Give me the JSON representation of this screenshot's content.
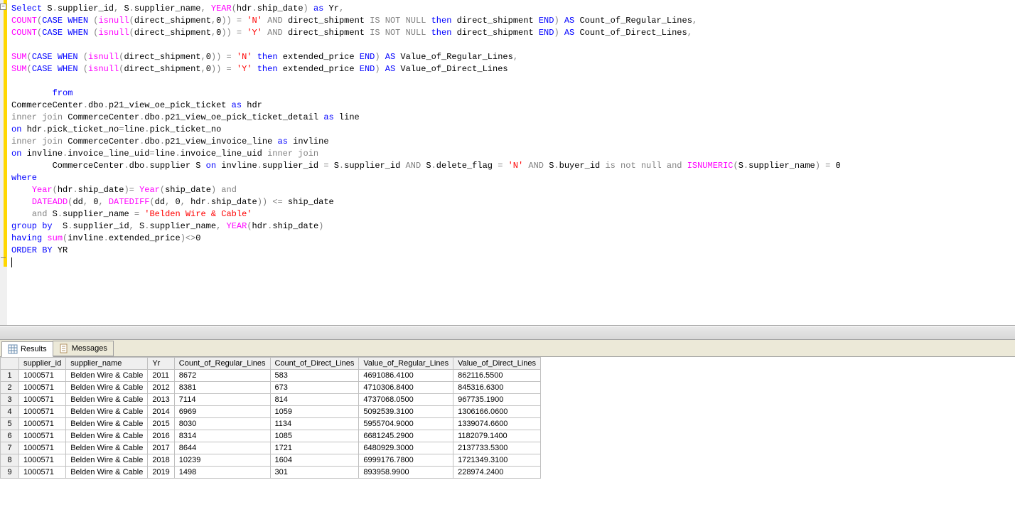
{
  "tabs": {
    "results": "Results",
    "messages": "Messages"
  },
  "sql_tokens": [
    [
      {
        "t": "Select",
        "c": "kw-blue"
      },
      {
        "t": " S"
      },
      {
        "t": ".",
        "c": "kw-gray"
      },
      {
        "t": "supplier_id"
      },
      {
        "t": ",",
        "c": "kw-gray"
      },
      {
        "t": " S"
      },
      {
        "t": ".",
        "c": "kw-gray"
      },
      {
        "t": "supplier_name"
      },
      {
        "t": ",",
        "c": "kw-gray"
      },
      {
        "t": " "
      },
      {
        "t": "YEAR",
        "c": "kw-mag"
      },
      {
        "t": "(",
        "c": "kw-gray"
      },
      {
        "t": "hdr"
      },
      {
        "t": ".",
        "c": "kw-gray"
      },
      {
        "t": "ship_date"
      },
      {
        "t": ")",
        "c": "kw-gray"
      },
      {
        "t": " "
      },
      {
        "t": "as",
        "c": "kw-blue"
      },
      {
        "t": " Yr"
      },
      {
        "t": ",",
        "c": "kw-gray"
      }
    ],
    [
      {
        "t": "COUNT",
        "c": "kw-mag"
      },
      {
        "t": "(",
        "c": "kw-gray"
      },
      {
        "t": "CASE",
        "c": "kw-blue"
      },
      {
        "t": " "
      },
      {
        "t": "WHEN",
        "c": "kw-blue"
      },
      {
        "t": " "
      },
      {
        "t": "(",
        "c": "kw-gray"
      },
      {
        "t": "isnull",
        "c": "kw-mag"
      },
      {
        "t": "(",
        "c": "kw-gray"
      },
      {
        "t": "direct_shipment"
      },
      {
        "t": ",",
        "c": "kw-gray"
      },
      {
        "t": "0"
      },
      {
        "t": "))",
        "c": "kw-gray"
      },
      {
        "t": " "
      },
      {
        "t": "=",
        "c": "kw-gray"
      },
      {
        "t": " "
      },
      {
        "t": "'N'",
        "c": "kw-red"
      },
      {
        "t": " "
      },
      {
        "t": "AND",
        "c": "kw-gray"
      },
      {
        "t": " direct_shipment "
      },
      {
        "t": "IS",
        "c": "kw-gray"
      },
      {
        "t": " "
      },
      {
        "t": "NOT",
        "c": "kw-gray"
      },
      {
        "t": " "
      },
      {
        "t": "NULL",
        "c": "kw-gray"
      },
      {
        "t": " "
      },
      {
        "t": "then",
        "c": "kw-blue"
      },
      {
        "t": " direct_shipment "
      },
      {
        "t": "END",
        "c": "kw-blue"
      },
      {
        "t": ")",
        "c": "kw-gray"
      },
      {
        "t": " "
      },
      {
        "t": "AS",
        "c": "kw-blue"
      },
      {
        "t": " Count_of_Regular_Lines"
      },
      {
        "t": ",",
        "c": "kw-gray"
      }
    ],
    [
      {
        "t": "COUNT",
        "c": "kw-mag"
      },
      {
        "t": "(",
        "c": "kw-gray"
      },
      {
        "t": "CASE",
        "c": "kw-blue"
      },
      {
        "t": " "
      },
      {
        "t": "WHEN",
        "c": "kw-blue"
      },
      {
        "t": " "
      },
      {
        "t": "(",
        "c": "kw-gray"
      },
      {
        "t": "isnull",
        "c": "kw-mag"
      },
      {
        "t": "(",
        "c": "kw-gray"
      },
      {
        "t": "direct_shipment"
      },
      {
        "t": ",",
        "c": "kw-gray"
      },
      {
        "t": "0"
      },
      {
        "t": "))",
        "c": "kw-gray"
      },
      {
        "t": " "
      },
      {
        "t": "=",
        "c": "kw-gray"
      },
      {
        "t": " "
      },
      {
        "t": "'Y'",
        "c": "kw-red"
      },
      {
        "t": " "
      },
      {
        "t": "AND",
        "c": "kw-gray"
      },
      {
        "t": " direct_shipment "
      },
      {
        "t": "IS",
        "c": "kw-gray"
      },
      {
        "t": " "
      },
      {
        "t": "NOT",
        "c": "kw-gray"
      },
      {
        "t": " "
      },
      {
        "t": "NULL",
        "c": "kw-gray"
      },
      {
        "t": " "
      },
      {
        "t": "then",
        "c": "kw-blue"
      },
      {
        "t": " direct_shipment "
      },
      {
        "t": "END",
        "c": "kw-blue"
      },
      {
        "t": ")",
        "c": "kw-gray"
      },
      {
        "t": " "
      },
      {
        "t": "AS",
        "c": "kw-blue"
      },
      {
        "t": " Count_of_Direct_Lines"
      },
      {
        "t": ",",
        "c": "kw-gray"
      }
    ],
    [],
    [
      {
        "t": "SUM",
        "c": "kw-mag"
      },
      {
        "t": "(",
        "c": "kw-gray"
      },
      {
        "t": "CASE",
        "c": "kw-blue"
      },
      {
        "t": " "
      },
      {
        "t": "WHEN",
        "c": "kw-blue"
      },
      {
        "t": " "
      },
      {
        "t": "(",
        "c": "kw-gray"
      },
      {
        "t": "isnull",
        "c": "kw-mag"
      },
      {
        "t": "(",
        "c": "kw-gray"
      },
      {
        "t": "direct_shipment"
      },
      {
        "t": ",",
        "c": "kw-gray"
      },
      {
        "t": "0"
      },
      {
        "t": "))",
        "c": "kw-gray"
      },
      {
        "t": " "
      },
      {
        "t": "=",
        "c": "kw-gray"
      },
      {
        "t": " "
      },
      {
        "t": "'N'",
        "c": "kw-red"
      },
      {
        "t": " "
      },
      {
        "t": "then",
        "c": "kw-blue"
      },
      {
        "t": " extended_price "
      },
      {
        "t": "END",
        "c": "kw-blue"
      },
      {
        "t": ")",
        "c": "kw-gray"
      },
      {
        "t": " "
      },
      {
        "t": "AS",
        "c": "kw-blue"
      },
      {
        "t": " Value_of_Regular_Lines"
      },
      {
        "t": ",",
        "c": "kw-gray"
      }
    ],
    [
      {
        "t": "SUM",
        "c": "kw-mag"
      },
      {
        "t": "(",
        "c": "kw-gray"
      },
      {
        "t": "CASE",
        "c": "kw-blue"
      },
      {
        "t": " "
      },
      {
        "t": "WHEN",
        "c": "kw-blue"
      },
      {
        "t": " "
      },
      {
        "t": "(",
        "c": "kw-gray"
      },
      {
        "t": "isnull",
        "c": "kw-mag"
      },
      {
        "t": "(",
        "c": "kw-gray"
      },
      {
        "t": "direct_shipment"
      },
      {
        "t": ",",
        "c": "kw-gray"
      },
      {
        "t": "0"
      },
      {
        "t": "))",
        "c": "kw-gray"
      },
      {
        "t": " "
      },
      {
        "t": "=",
        "c": "kw-gray"
      },
      {
        "t": " "
      },
      {
        "t": "'Y'",
        "c": "kw-red"
      },
      {
        "t": " "
      },
      {
        "t": "then",
        "c": "kw-blue"
      },
      {
        "t": " extended_price "
      },
      {
        "t": "END",
        "c": "kw-blue"
      },
      {
        "t": ")",
        "c": "kw-gray"
      },
      {
        "t": " "
      },
      {
        "t": "AS",
        "c": "kw-blue"
      },
      {
        "t": " Value_of_Direct_Lines"
      }
    ],
    [],
    [
      {
        "t": "        "
      },
      {
        "t": "from",
        "c": "kw-blue"
      }
    ],
    [
      {
        "t": "CommerceCenter"
      },
      {
        "t": ".",
        "c": "kw-gray"
      },
      {
        "t": "dbo"
      },
      {
        "t": ".",
        "c": "kw-gray"
      },
      {
        "t": "p21_view_oe_pick_ticket "
      },
      {
        "t": "as",
        "c": "kw-blue"
      },
      {
        "t": " hdr"
      }
    ],
    [
      {
        "t": "inner",
        "c": "kw-gray"
      },
      {
        "t": " "
      },
      {
        "t": "join",
        "c": "kw-gray"
      },
      {
        "t": " CommerceCenter"
      },
      {
        "t": ".",
        "c": "kw-gray"
      },
      {
        "t": "dbo"
      },
      {
        "t": ".",
        "c": "kw-gray"
      },
      {
        "t": "p21_view_oe_pick_ticket_detail "
      },
      {
        "t": "as",
        "c": "kw-blue"
      },
      {
        "t": " line"
      }
    ],
    [
      {
        "t": "on",
        "c": "kw-blue"
      },
      {
        "t": " hdr"
      },
      {
        "t": ".",
        "c": "kw-gray"
      },
      {
        "t": "pick_ticket_no"
      },
      {
        "t": "=",
        "c": "kw-gray"
      },
      {
        "t": "line"
      },
      {
        "t": ".",
        "c": "kw-gray"
      },
      {
        "t": "pick_ticket_no"
      }
    ],
    [
      {
        "t": "inner",
        "c": "kw-gray"
      },
      {
        "t": " "
      },
      {
        "t": "join",
        "c": "kw-gray"
      },
      {
        "t": " CommerceCenter"
      },
      {
        "t": ".",
        "c": "kw-gray"
      },
      {
        "t": "dbo"
      },
      {
        "t": ".",
        "c": "kw-gray"
      },
      {
        "t": "p21_view_invoice_line "
      },
      {
        "t": "as",
        "c": "kw-blue"
      },
      {
        "t": " invline"
      }
    ],
    [
      {
        "t": "on",
        "c": "kw-blue"
      },
      {
        "t": " invline"
      },
      {
        "t": ".",
        "c": "kw-gray"
      },
      {
        "t": "invoice_line_uid"
      },
      {
        "t": "=",
        "c": "kw-gray"
      },
      {
        "t": "line"
      },
      {
        "t": ".",
        "c": "kw-gray"
      },
      {
        "t": "invoice_line_uid "
      },
      {
        "t": "inner",
        "c": "kw-gray"
      },
      {
        "t": " "
      },
      {
        "t": "join",
        "c": "kw-gray"
      }
    ],
    [
      {
        "t": "        CommerceCenter"
      },
      {
        "t": ".",
        "c": "kw-gray"
      },
      {
        "t": "dbo"
      },
      {
        "t": ".",
        "c": "kw-gray"
      },
      {
        "t": "supplier S "
      },
      {
        "t": "on",
        "c": "kw-blue"
      },
      {
        "t": " invline"
      },
      {
        "t": ".",
        "c": "kw-gray"
      },
      {
        "t": "supplier_id "
      },
      {
        "t": "=",
        "c": "kw-gray"
      },
      {
        "t": " S"
      },
      {
        "t": ".",
        "c": "kw-gray"
      },
      {
        "t": "supplier_id "
      },
      {
        "t": "AND",
        "c": "kw-gray"
      },
      {
        "t": " S"
      },
      {
        "t": ".",
        "c": "kw-gray"
      },
      {
        "t": "delete_flag "
      },
      {
        "t": "=",
        "c": "kw-gray"
      },
      {
        "t": " "
      },
      {
        "t": "'N'",
        "c": "kw-red"
      },
      {
        "t": " "
      },
      {
        "t": "AND",
        "c": "kw-gray"
      },
      {
        "t": " S"
      },
      {
        "t": ".",
        "c": "kw-gray"
      },
      {
        "t": "buyer_id "
      },
      {
        "t": "is",
        "c": "kw-gray"
      },
      {
        "t": " "
      },
      {
        "t": "not",
        "c": "kw-gray"
      },
      {
        "t": " "
      },
      {
        "t": "null",
        "c": "kw-gray"
      },
      {
        "t": " "
      },
      {
        "t": "and",
        "c": "kw-gray"
      },
      {
        "t": " "
      },
      {
        "t": "ISNUMERIC",
        "c": "kw-mag"
      },
      {
        "t": "(",
        "c": "kw-gray"
      },
      {
        "t": "S"
      },
      {
        "t": ".",
        "c": "kw-gray"
      },
      {
        "t": "supplier_name"
      },
      {
        "t": ")",
        "c": "kw-gray"
      },
      {
        "t": " "
      },
      {
        "t": "=",
        "c": "kw-gray"
      },
      {
        "t": " 0"
      }
    ],
    [
      {
        "t": "where",
        "c": "kw-blue"
      }
    ],
    [
      {
        "t": "    "
      },
      {
        "t": "Year",
        "c": "kw-mag"
      },
      {
        "t": "(",
        "c": "kw-gray"
      },
      {
        "t": "hdr"
      },
      {
        "t": ".",
        "c": "kw-gray"
      },
      {
        "t": "ship_date"
      },
      {
        "t": ")=",
        "c": "kw-gray"
      },
      {
        "t": " "
      },
      {
        "t": "Year",
        "c": "kw-mag"
      },
      {
        "t": "(",
        "c": "kw-gray"
      },
      {
        "t": "ship_date"
      },
      {
        "t": ")",
        "c": "kw-gray"
      },
      {
        "t": " "
      },
      {
        "t": "and",
        "c": "kw-gray"
      }
    ],
    [
      {
        "t": "    "
      },
      {
        "t": "DATEADD",
        "c": "kw-mag"
      },
      {
        "t": "(",
        "c": "kw-gray"
      },
      {
        "t": "dd"
      },
      {
        "t": ",",
        "c": "kw-gray"
      },
      {
        "t": " 0"
      },
      {
        "t": ",",
        "c": "kw-gray"
      },
      {
        "t": " "
      },
      {
        "t": "DATEDIFF",
        "c": "kw-mag"
      },
      {
        "t": "(",
        "c": "kw-gray"
      },
      {
        "t": "dd"
      },
      {
        "t": ",",
        "c": "kw-gray"
      },
      {
        "t": " 0"
      },
      {
        "t": ",",
        "c": "kw-gray"
      },
      {
        "t": " hdr"
      },
      {
        "t": ".",
        "c": "kw-gray"
      },
      {
        "t": "ship_date"
      },
      {
        "t": "))",
        "c": "kw-gray"
      },
      {
        "t": " "
      },
      {
        "t": "<=",
        "c": "kw-gray"
      },
      {
        "t": " ship_date"
      }
    ],
    [
      {
        "t": "    "
      },
      {
        "t": "and",
        "c": "kw-gray"
      },
      {
        "t": " S"
      },
      {
        "t": ".",
        "c": "kw-gray"
      },
      {
        "t": "supplier_name "
      },
      {
        "t": "=",
        "c": "kw-gray"
      },
      {
        "t": " "
      },
      {
        "t": "'Belden Wire & Cable'",
        "c": "kw-red"
      }
    ],
    [
      {
        "t": "group",
        "c": "kw-blue"
      },
      {
        "t": " "
      },
      {
        "t": "by",
        "c": "kw-blue"
      },
      {
        "t": "  S"
      },
      {
        "t": ".",
        "c": "kw-gray"
      },
      {
        "t": "supplier_id"
      },
      {
        "t": ",",
        "c": "kw-gray"
      },
      {
        "t": " S"
      },
      {
        "t": ".",
        "c": "kw-gray"
      },
      {
        "t": "supplier_name"
      },
      {
        "t": ",",
        "c": "kw-gray"
      },
      {
        "t": " "
      },
      {
        "t": "YEAR",
        "c": "kw-mag"
      },
      {
        "t": "(",
        "c": "kw-gray"
      },
      {
        "t": "hdr"
      },
      {
        "t": ".",
        "c": "kw-gray"
      },
      {
        "t": "ship_date"
      },
      {
        "t": ")",
        "c": "kw-gray"
      }
    ],
    [
      {
        "t": "having",
        "c": "kw-blue"
      },
      {
        "t": " "
      },
      {
        "t": "sum",
        "c": "kw-mag"
      },
      {
        "t": "(",
        "c": "kw-gray"
      },
      {
        "t": "invline"
      },
      {
        "t": ".",
        "c": "kw-gray"
      },
      {
        "t": "extended_price"
      },
      {
        "t": ")<>",
        "c": "kw-gray"
      },
      {
        "t": "0"
      }
    ],
    [
      {
        "t": "ORDER",
        "c": "kw-blue"
      },
      {
        "t": " "
      },
      {
        "t": "BY",
        "c": "kw-blue"
      },
      {
        "t": " YR"
      }
    ]
  ],
  "results": {
    "columns": [
      "supplier_id",
      "supplier_name",
      "Yr",
      "Count_of_Regular_Lines",
      "Count_of_Direct_Lines",
      "Value_of_Regular_Lines",
      "Value_of_Direct_Lines"
    ],
    "col_classes": [
      "col-sid",
      "col-sname",
      "col-yr",
      "col-crl",
      "col-cdl",
      "col-vrl",
      "col-vdl"
    ],
    "rows": [
      [
        "1000571",
        "Belden Wire & Cable",
        "2011",
        "8672",
        "583",
        "4691086.4100",
        "862116.5500"
      ],
      [
        "1000571",
        "Belden Wire & Cable",
        "2012",
        "8381",
        "673",
        "4710306.8400",
        "845316.6300"
      ],
      [
        "1000571",
        "Belden Wire & Cable",
        "2013",
        "7114",
        "814",
        "4737068.0500",
        "967735.1900"
      ],
      [
        "1000571",
        "Belden Wire & Cable",
        "2014",
        "6969",
        "1059",
        "5092539.3100",
        "1306166.0600"
      ],
      [
        "1000571",
        "Belden Wire & Cable",
        "2015",
        "8030",
        "1134",
        "5955704.9000",
        "1339074.6600"
      ],
      [
        "1000571",
        "Belden Wire & Cable",
        "2016",
        "8314",
        "1085",
        "6681245.2900",
        "1182079.1400"
      ],
      [
        "1000571",
        "Belden Wire & Cable",
        "2017",
        "8644",
        "1721",
        "6480929.3000",
        "2137733.5300"
      ],
      [
        "1000571",
        "Belden Wire & Cable",
        "2018",
        "10239",
        "1604",
        "6999176.7800",
        "1721349.3100"
      ],
      [
        "1000571",
        "Belden Wire & Cable",
        "2019",
        "1498",
        "301",
        "893958.9900",
        "228974.2400"
      ]
    ]
  }
}
